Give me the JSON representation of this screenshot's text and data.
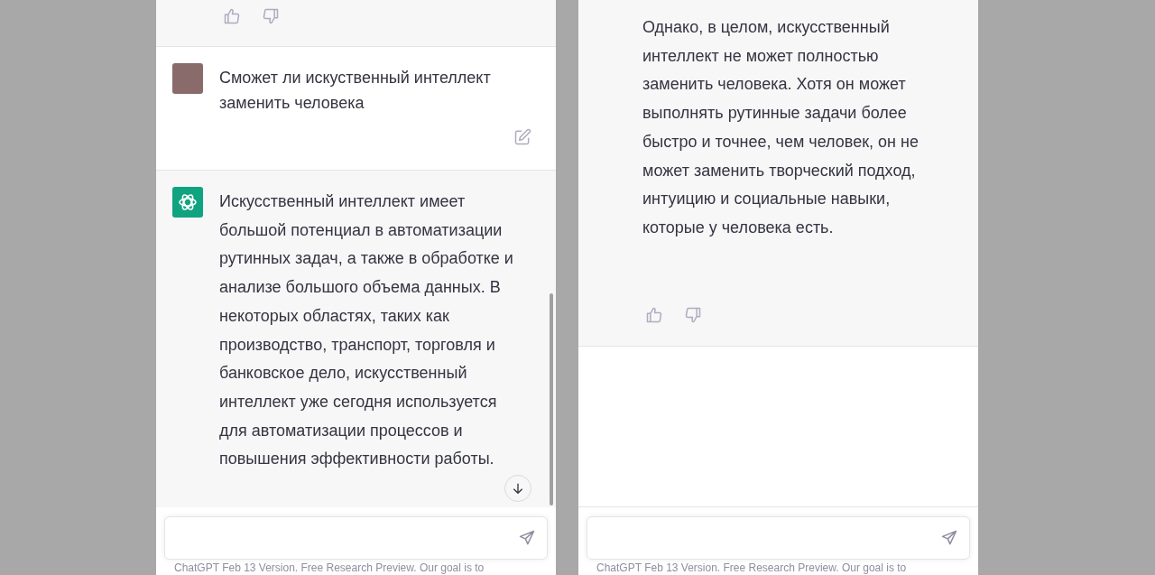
{
  "panels": [
    {
      "blocks": [
        {
          "kind": "feedback"
        },
        {
          "kind": "user",
          "text": "Сможет ли искуственный интеллект заменить человека"
        },
        {
          "kind": "assistant",
          "text": "Искусственный интеллект имеет большой потенциал в автоматизации рутинных задач, а также в обработке и анализе большого объема данных. В некоторых областях, таких как производство, транспорт, торговля и банковское дело, искусственный интеллект уже сегодня используется для автоматизации процессов и повышения эффективности работы."
        }
      ],
      "scroll_down": true,
      "footer": "ChatGPT Feb 13 Version. Free Research Preview. Our goal is to"
    },
    {
      "blocks": [
        {
          "kind": "continued",
          "text": "Однако, в целом, искусственный интеллект не может полностью заменить человека. Хотя он может выполнять рутинные задачи более быстро и точнее, чем человек, он не может заменить творческий подход, интуицию и социальные навыки, которые у человека есть."
        },
        {
          "kind": "blank"
        }
      ],
      "scroll_down": false,
      "footer": "ChatGPT Feb 13 Version. Free Research Preview. Our goal is to"
    }
  ]
}
